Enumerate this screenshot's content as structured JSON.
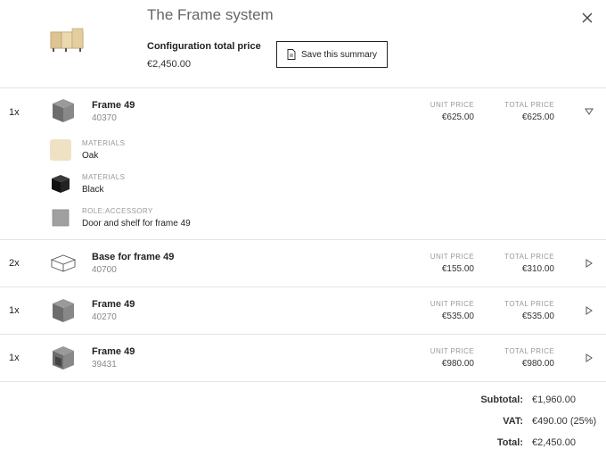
{
  "header": {
    "title": "The Frame system",
    "config_label": "Configuration total price",
    "config_price": "€2,450.00",
    "save_label": "Save this summary"
  },
  "columns": {
    "unit_price": "UNIT PRICE",
    "total_price": "TOTAL PRICE"
  },
  "items": [
    {
      "qty": "1x",
      "name": "Frame 49",
      "code": "40370",
      "unit_price": "€625.00",
      "total_price": "€625.00",
      "expanded": true,
      "details": [
        {
          "label": "MATERIALS",
          "value": "Oak",
          "swatch_color": "#efe2c4"
        },
        {
          "label": "MATERIALS",
          "value": "Black",
          "swatch_color": "#1a1a1a"
        },
        {
          "label": "ROLE:ACCESSORY",
          "value": "Door and shelf for frame 49",
          "swatch_color": "#9a9a9a"
        }
      ]
    },
    {
      "qty": "2x",
      "name": "Base for frame 49",
      "code": "40700",
      "unit_price": "€155.00",
      "total_price": "€310.00",
      "expanded": false
    },
    {
      "qty": "1x",
      "name": "Frame 49",
      "code": "40270",
      "unit_price": "€535.00",
      "total_price": "€535.00",
      "expanded": false
    },
    {
      "qty": "1x",
      "name": "Frame 49",
      "code": "39431",
      "unit_price": "€980.00",
      "total_price": "€980.00",
      "expanded": false
    }
  ],
  "totals": {
    "subtotal_label": "Subtotal:",
    "subtotal": "€1,960.00",
    "vat_label": "VAT:",
    "vat": "€490.00 (25%)",
    "total_label": "Total:",
    "total": "€2,450.00"
  },
  "icons": {
    "close": "close-icon",
    "save": "document-icon",
    "expand": "chevron-down-icon",
    "collapse": "play-right-icon"
  }
}
